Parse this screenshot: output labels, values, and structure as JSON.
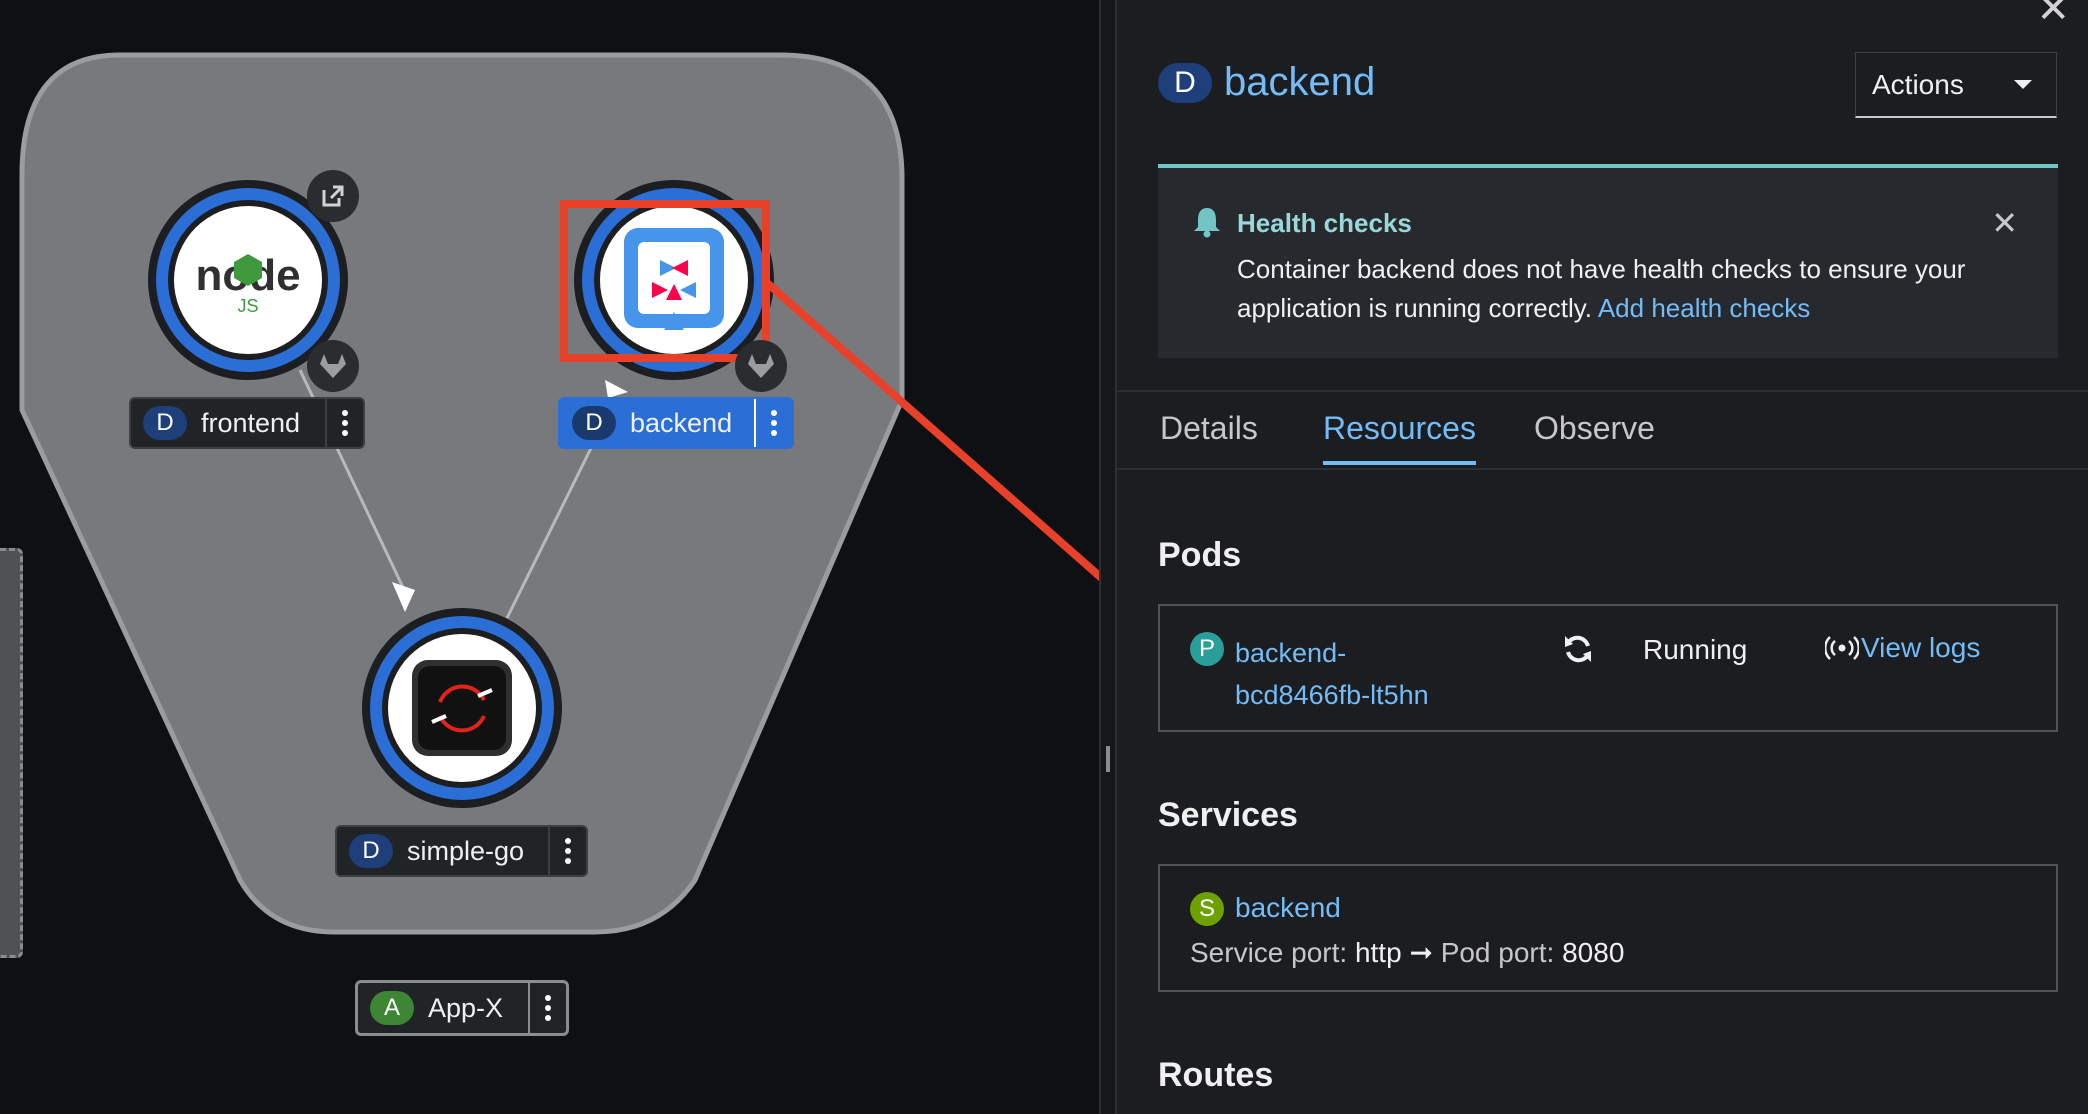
{
  "topology": {
    "nodes": [
      {
        "id": "frontend",
        "badge": "D",
        "label": "frontend",
        "runtime": "Node.js"
      },
      {
        "id": "backend",
        "badge": "D",
        "label": "backend",
        "runtime": "Quarkus",
        "selected": true
      },
      {
        "id": "simple-go",
        "badge": "D",
        "label": "simple-go",
        "runtime": "OpenShift"
      }
    ],
    "group": {
      "badge": "A",
      "label": "App-X"
    },
    "node_logo_text": {
      "frontend": "node",
      "frontend_sub": "JS"
    }
  },
  "panel": {
    "resource_badge": "D",
    "resource_name": "backend",
    "actions_label": "Actions",
    "alert": {
      "title": "Health checks",
      "message": "Container backend does not have health checks to ensure your application is running correctly.",
      "link": "Add health checks"
    },
    "tabs": [
      {
        "label": "Details",
        "active": false
      },
      {
        "label": "Resources",
        "active": true
      },
      {
        "label": "Observe",
        "active": false
      }
    ],
    "pods": {
      "title": "Pods",
      "items": [
        {
          "badge": "P",
          "name_line1": "backend-",
          "name_line2": "bcd8466fb-lt5hn",
          "status": "Running",
          "logs_link": "View logs"
        }
      ]
    },
    "services": {
      "title": "Services",
      "items": [
        {
          "badge": "S",
          "name": "backend",
          "service_port_label": "Service port:",
          "service_port": "http",
          "arrow": "➞",
          "pod_port_label": "Pod port:",
          "pod_port": "8080"
        }
      ]
    },
    "routes": {
      "title": "Routes"
    }
  },
  "colors": {
    "accent_blue": "#73bcf7",
    "selected_blue": "#2b6fd6",
    "annotation_red": "#e8412a",
    "alert_teal": "#73c5c5",
    "pod_badge": "#2a9f9a",
    "service_badge": "#6ca100",
    "app_badge": "#3e8635"
  },
  "icons": [
    "external-link-icon",
    "gitlab-icon",
    "bell-icon",
    "close-icon",
    "sync-icon",
    "broadcast-icon",
    "caret-down-icon",
    "kebab-icon"
  ]
}
